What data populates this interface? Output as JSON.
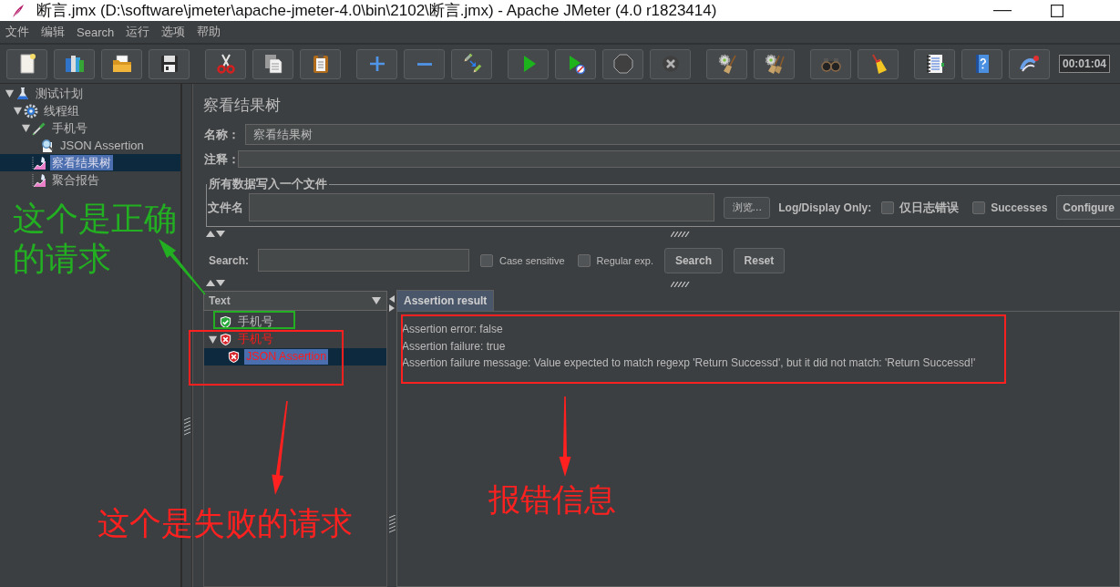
{
  "window": {
    "title": "断言.jmx (D:\\software\\jmeter\\apache-jmeter-4.0\\bin\\2102\\断言.jmx) - Apache JMeter (4.0 r1823414)"
  },
  "menu": [
    "文件",
    "编辑",
    "Search",
    "运行",
    "选项",
    "帮助"
  ],
  "toolbar": {
    "groups": [
      [
        {
          "kind": "new",
          "disabled": false
        },
        {
          "kind": "templates",
          "disabled": false
        },
        {
          "kind": "open",
          "disabled": false
        },
        {
          "kind": "save",
          "disabled": false
        }
      ],
      [
        {
          "kind": "cut",
          "disabled": false
        },
        {
          "kind": "copy",
          "disabled": false
        },
        {
          "kind": "paste",
          "disabled": false
        }
      ],
      [
        {
          "kind": "expand",
          "disabled": false
        },
        {
          "kind": "collapse",
          "disabled": false
        },
        {
          "kind": "toggle",
          "disabled": false
        }
      ],
      [
        {
          "kind": "start",
          "disabled": false
        },
        {
          "kind": "start_no_pauses",
          "disabled": false
        },
        {
          "kind": "stop",
          "disabled": true
        },
        {
          "kind": "shutdown",
          "disabled": true
        }
      ],
      [
        {
          "kind": "clear",
          "disabled": false
        },
        {
          "kind": "clear_all",
          "disabled": false
        }
      ],
      [
        {
          "kind": "search",
          "disabled": false
        },
        {
          "kind": "reset_search",
          "disabled": false
        }
      ],
      [
        {
          "kind": "function_helper",
          "disabled": false
        },
        {
          "kind": "help",
          "disabled": false
        },
        {
          "kind": "remote",
          "disabled": false
        }
      ]
    ],
    "timer": "00:01:04"
  },
  "tree": [
    {
      "label": "测试计划",
      "kind": "test_plan",
      "expanded": true,
      "selected": false,
      "children": [
        {
          "label": "线程组",
          "kind": "thread_group",
          "expanded": true,
          "selected": false,
          "children": [
            {
              "label": "手机号",
              "kind": "sampler",
              "expanded": true,
              "selected": false,
              "children": [
                {
                  "label": "JSON Assertion",
                  "kind": "assertion",
                  "selected": false
                }
              ]
            },
            {
              "label": "察看结果树",
              "kind": "listener",
              "selected": true
            },
            {
              "label": "聚合报告",
              "kind": "listener",
              "selected": false
            }
          ]
        }
      ]
    }
  ],
  "editor": {
    "title": "察看结果树",
    "name": {
      "label": "名称：",
      "value": "察看结果树"
    },
    "comment": {
      "label": "注释："
    },
    "file_section": {
      "title": "所有数据写入一个文件",
      "filename_label": "文件名",
      "browse_button": "浏览...",
      "log_label": "Log/Display Only:",
      "options": [
        {
          "label": "仅日志错误",
          "checked": false
        },
        {
          "label": "Successes",
          "checked": false
        }
      ],
      "configure_button": "Configure"
    },
    "search": {
      "label": "Search:",
      "options": [
        {
          "label": "Case sensitive",
          "checked": false
        },
        {
          "label": "Regular exp.",
          "checked": false
        }
      ],
      "buttons": [
        "Search",
        "Reset"
      ]
    },
    "results": {
      "renderer": "Text",
      "items": [
        {
          "label": "手机号",
          "passed": true,
          "selected": false
        },
        {
          "label": "手机号",
          "passed": false,
          "expanded": true,
          "selected": false,
          "children": [
            {
              "label": "JSON Assertion",
              "passed": false,
              "selected": true
            }
          ]
        }
      ],
      "tabs": [
        {
          "label": "Assertion result",
          "selected": true
        }
      ],
      "lines": [
        "Assertion error: false",
        "Assertion failure: true",
        "Assertion failure message: Value expected to match regexp 'Return Successd', but it did not match: 'Return Successd!'"
      ]
    }
  },
  "annotations": [
    {
      "kind": "text",
      "text": "这个是正确的请求",
      "color": "#22b022"
    },
    {
      "kind": "arrow",
      "color": "#22b022"
    },
    {
      "kind": "frame",
      "color": "#22b022"
    },
    {
      "kind": "frame",
      "color": "#ff2020"
    },
    {
      "kind": "arrow",
      "color": "#ff2020"
    },
    {
      "kind": "text",
      "text": "这个是失败的请求",
      "color": "#ff2020"
    },
    {
      "kind": "frame",
      "color": "#ff2020"
    },
    {
      "kind": "arrow",
      "color": "#ff2020"
    },
    {
      "kind": "text",
      "text": "报错信息",
      "color": "#ff2020"
    }
  ]
}
